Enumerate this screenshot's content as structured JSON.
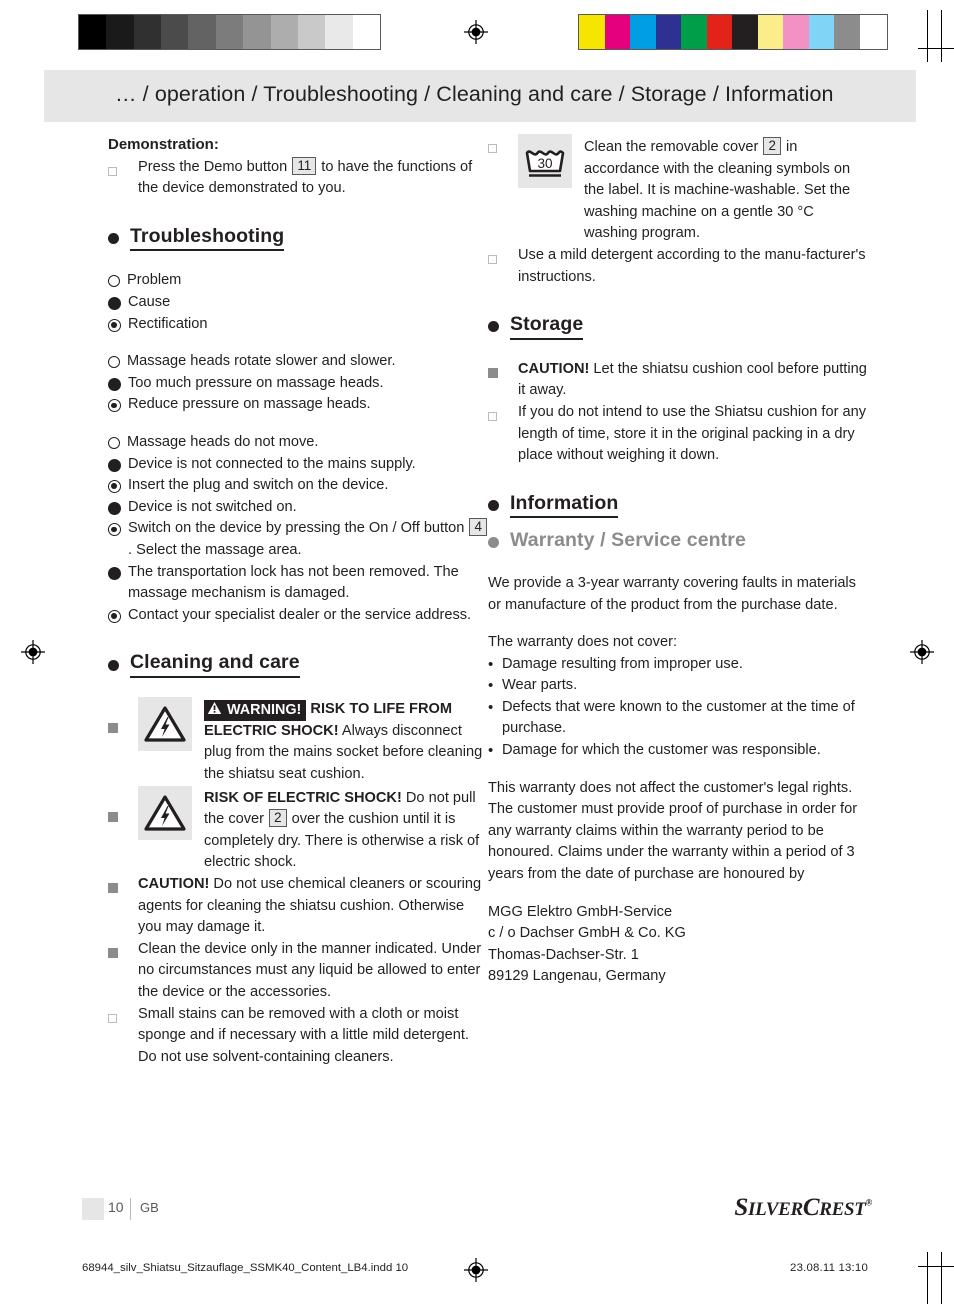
{
  "calibration": {
    "grayscale": [
      "#000000",
      "#1a1a1a",
      "#303030",
      "#4b4b4b",
      "#636363",
      "#7c7c7c",
      "#949494",
      "#adadad",
      "#c9c9c9",
      "#e9e9e9",
      "#ffffff"
    ],
    "colors": [
      "#f5e500",
      "#e5007d",
      "#009fe3",
      "#2e3192",
      "#009e49",
      "#e2231a",
      "#231f20",
      "#fbee8a",
      "#f390c4",
      "#80d4f5",
      "#8c8c8c"
    ]
  },
  "header": {
    "breadcrumb": "… / operation / Troubleshooting / Cleaning and care / Storage / Information"
  },
  "left_column": {
    "demonstration": {
      "heading": "Demonstration:",
      "items": [
        {
          "marker": "square-outline",
          "parts": [
            "Press the Demo button ",
            {
              "ref": "11"
            },
            " to have the functions of the device demonstrated to you."
          ]
        }
      ]
    },
    "troubleshooting": {
      "heading": "Troubleshooting",
      "legend": [
        {
          "marker": "circle-outline",
          "label": "Problem"
        },
        {
          "marker": "circle-filled",
          "label": "Cause"
        },
        {
          "marker": "circle-target",
          "label": "Rectification"
        }
      ],
      "groups": [
        [
          {
            "marker": "circle-outline",
            "text": "Massage heads rotate slower and slower."
          },
          {
            "marker": "circle-filled",
            "text": "Too much pressure on massage heads."
          },
          {
            "marker": "circle-target",
            "text": "Reduce pressure on massage heads."
          }
        ],
        [
          {
            "marker": "circle-outline",
            "text": "Massage heads do not move."
          },
          {
            "marker": "circle-filled",
            "text": "Device is not connected to the mains supply."
          },
          {
            "marker": "circle-target",
            "text": "Insert the plug and switch on the device."
          },
          {
            "marker": "circle-filled",
            "text": "Device is not switched on."
          },
          {
            "marker": "circle-target",
            "text": "Switch on the device by pressing the On / Off button ",
            "ref": "4",
            "text_after": ". Select the massage area."
          },
          {
            "marker": "circle-filled",
            "text": "The transportation lock has not been removed. The massage mechanism is damaged."
          },
          {
            "marker": "circle-target",
            "text": "Contact your specialist dealer or the service address."
          }
        ]
      ]
    },
    "cleaning": {
      "heading": "Cleaning and care",
      "warning_badge": "WARNING!",
      "item1": {
        "marker": "square-filled",
        "icon": "electric-shock-triangle-icon",
        "bold_1": "RISK TO LIFE FROM ELECTRIC SHOCK!",
        "body_1": " Always disconnect plug from the mains socket before cleaning the shiatsu seat cushion."
      },
      "item2": {
        "marker": "square-filled",
        "icon": "electric-shock-triangle-icon",
        "bold_1": "RISK OF ELECTRIC SHOCK!",
        "body_a": " Do not pull the cover ",
        "ref": "2",
        "body_b": " over the cushion until it is completely dry. There is otherwise a risk of electric shock."
      },
      "item3": {
        "marker": "square-filled",
        "bold": "CAUTION!",
        "body": " Do not use chemical cleaners or scouring agents for cleaning the shiatsu cushion. Otherwise you may damage it."
      },
      "item4": {
        "marker": "square-filled",
        "body": "Clean the device only in the manner indicated. Under no circumstances must any liquid be allowed to enter the device or the accessories."
      },
      "item5": {
        "marker": "square-outline",
        "body": "Small stains can be removed with a cloth or moist sponge and if necessary with a little mild detergent. Do not use solvent-containing cleaners."
      }
    }
  },
  "right_column": {
    "washing": {
      "item1": {
        "marker": "square-outline",
        "icon": "wash-30-degrees-icon",
        "icon_label": "30",
        "body_a": "Clean the removable cover ",
        "ref": "2",
        "body_b": " in accordance with the cleaning symbols on the label. It is machine-washable. Set the washing machine on a gentle 30 °C washing program."
      },
      "item2": {
        "marker": "square-outline",
        "body": "Use a mild detergent according to the manu-facturer's instructions."
      }
    },
    "storage": {
      "heading": "Storage",
      "item1": {
        "marker": "square-filled",
        "bold": "CAUTION!",
        "body": " Let the shiatsu cushion cool before putting it away."
      },
      "item2": {
        "marker": "square-outline",
        "body": "If you do not intend to use the Shiatsu cushion for any length of time, store it in the original packing in a dry place without weighing it down."
      }
    },
    "information": {
      "heading": "Information",
      "subheading": "Warranty / Service centre",
      "para1": "We provide a 3-year warranty covering faults in materials or manufacture of the product from the purchase date.",
      "para2_intro": "The warranty does not cover:",
      "exclusions": [
        "Damage resulting from improper use.",
        "Wear parts.",
        "Defects that were known to the customer at the time of purchase.",
        "Damage for which the customer was responsible."
      ],
      "para3": "This warranty does not affect the customer's legal rights.",
      "para4": "The customer must provide proof of purchase in order for any warranty claims within the warranty period to be honoured. Claims under the warranty within a period of 3 years from the date of purchase are honoured by",
      "address": [
        "MGG Elektro GmbH-Service",
        "c / o Dachser GmbH & Co. KG",
        "Thomas-Dachser-Str. 1",
        "89129 Langenau, Germany"
      ]
    }
  },
  "footer": {
    "page_number": "10",
    "locale": "GB",
    "brand_part1": "S",
    "brand_part2": "ILVER",
    "brand_part3": "C",
    "brand_part4": "REST",
    "brand_mark": "®"
  },
  "print_marks": {
    "filename": "68944_silv_Shiatsu_Sitzauflage_SSMK40_Content_LB4.indd   10",
    "datetime": "23.08.11   13:10"
  }
}
